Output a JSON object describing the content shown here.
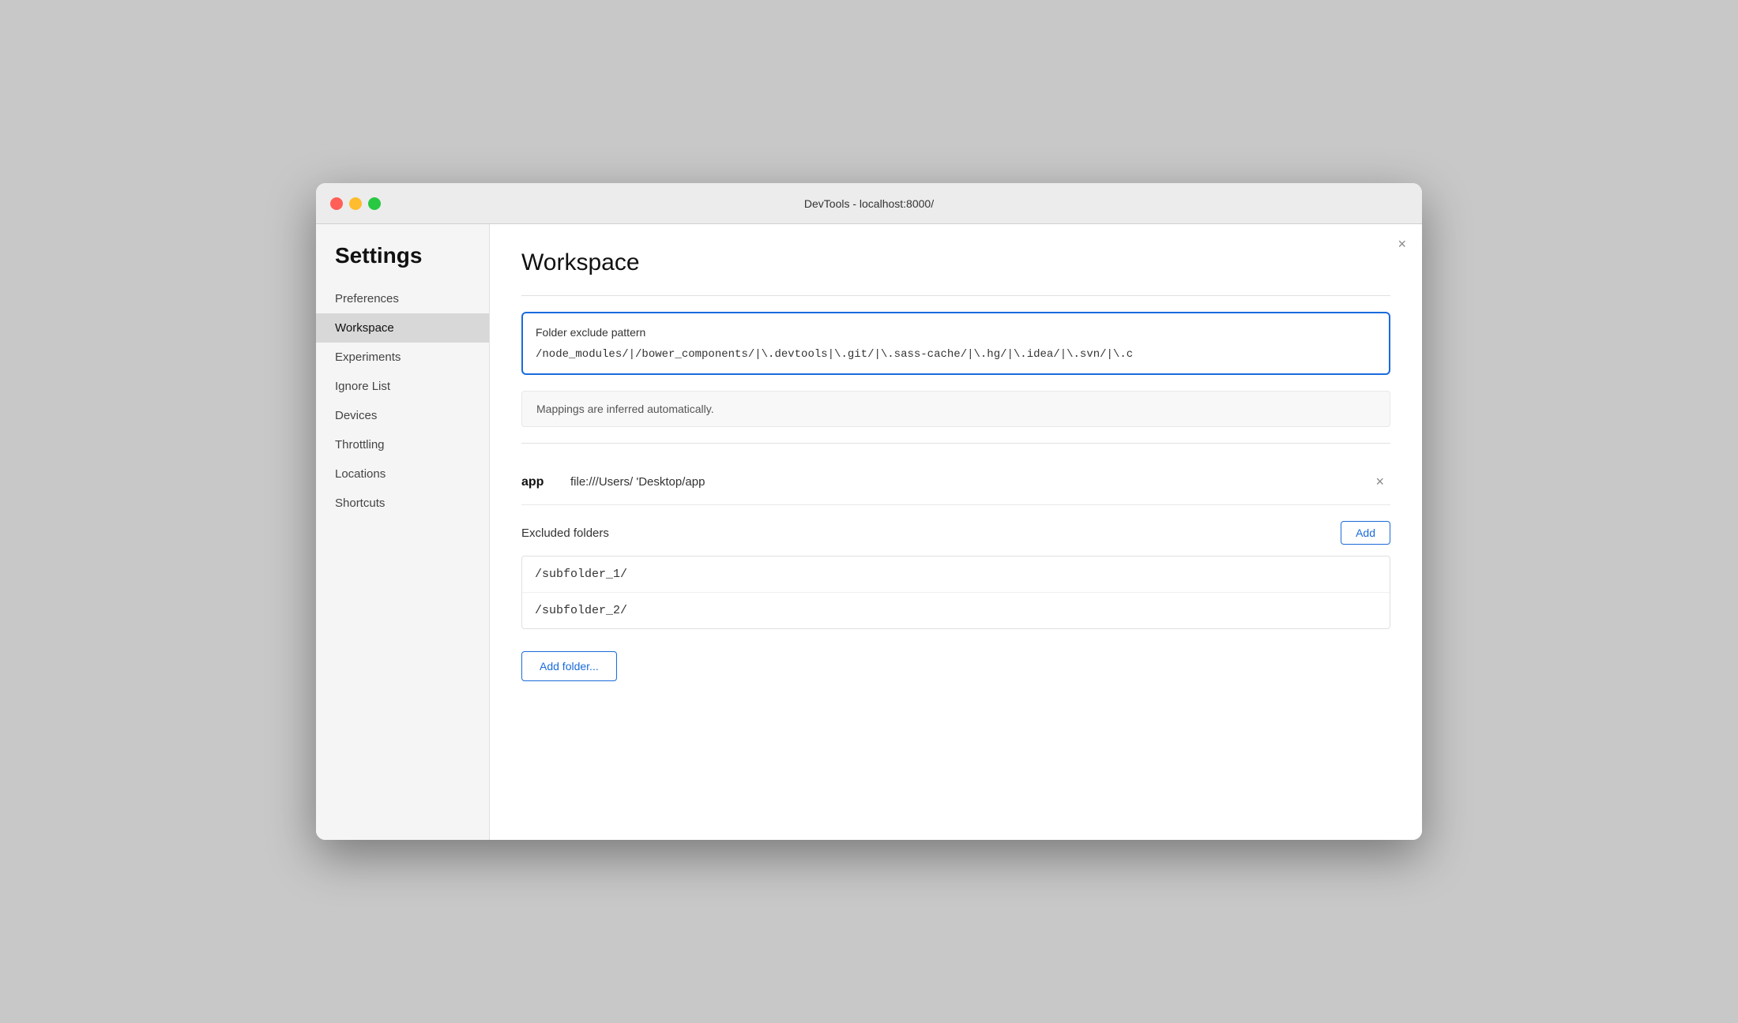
{
  "window": {
    "title": "DevTools - localhost:8000/"
  },
  "traffic_lights": {
    "close_label": "close",
    "minimize_label": "minimize",
    "maximize_label": "maximize"
  },
  "sidebar": {
    "heading": "Settings",
    "items": [
      {
        "id": "preferences",
        "label": "Preferences",
        "active": false
      },
      {
        "id": "workspace",
        "label": "Workspace",
        "active": true
      },
      {
        "id": "experiments",
        "label": "Experiments",
        "active": false
      },
      {
        "id": "ignore-list",
        "label": "Ignore List",
        "active": false
      },
      {
        "id": "devices",
        "label": "Devices",
        "active": false
      },
      {
        "id": "throttling",
        "label": "Throttling",
        "active": false
      },
      {
        "id": "locations",
        "label": "Locations",
        "active": false
      },
      {
        "id": "shortcuts",
        "label": "Shortcuts",
        "active": false
      }
    ]
  },
  "main": {
    "page_title": "Workspace",
    "close_label": "×",
    "folder_exclude": {
      "label": "Folder exclude pattern",
      "value": "/node_modules/|/bower_components/|\\.devtools|\\.git/|\\.sass-cache/|\\.hg/|\\.idea/|\\.svn/|\\.c"
    },
    "mappings_note": "Mappings are inferred automatically.",
    "workspace_entry": {
      "name": "app",
      "path": "file:///Users/      'Desktop/app"
    },
    "remove_entry_label": "×",
    "excluded_folders": {
      "label": "Excluded folders",
      "add_button_label": "Add",
      "folders": [
        "/subfolder_1/",
        "/subfolder_2/"
      ]
    },
    "add_folder_button_label": "Add folder..."
  }
}
